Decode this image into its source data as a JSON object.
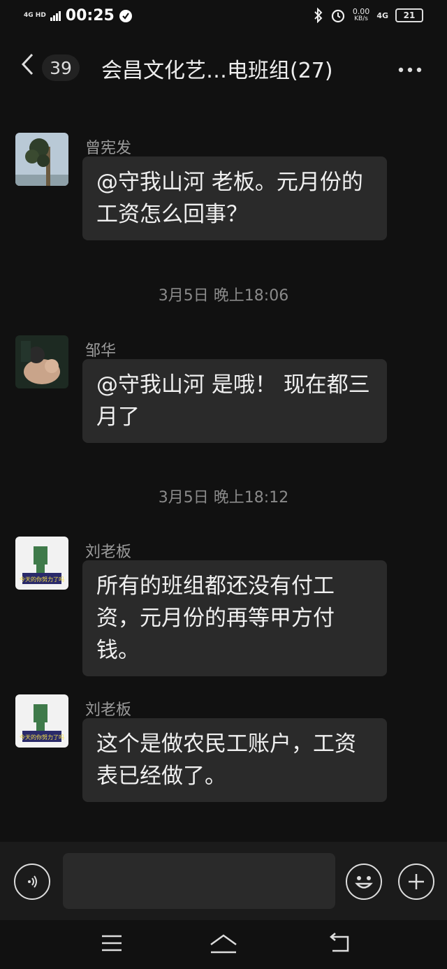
{
  "status_bar": {
    "network": "4G HD",
    "time": "00:25",
    "speed": "0.00",
    "speed_unit": "KB/s",
    "signal": "4G",
    "battery": "21"
  },
  "header": {
    "unread_count": "39",
    "title": "会昌文化艺…电班组(27)"
  },
  "timestamps": [
    "3月5日 晚上18:06",
    "3月5日 晚上18:12"
  ],
  "messages": [
    {
      "sender": "曾宪发",
      "text": "@守我山河  老板。元月份的工资怎么回事？"
    },
    {
      "sender": "邹华",
      "text": "@守我山河  是哦！ 现在都三月了"
    },
    {
      "sender": "刘老板",
      "text": "所有的班组都还没有付工资，元月份的再等甲方付钱。"
    },
    {
      "sender": "刘老板",
      "text": "这个是做农民工账户，工资表已经做了。"
    }
  ],
  "avatar_texts": {
    "boss": "今天的你努力了吗"
  },
  "input": {
    "placeholder": ""
  },
  "colors": {
    "background": "#111111",
    "bubble": "#2a2a2a",
    "input_bar": "#1b1b1b"
  }
}
